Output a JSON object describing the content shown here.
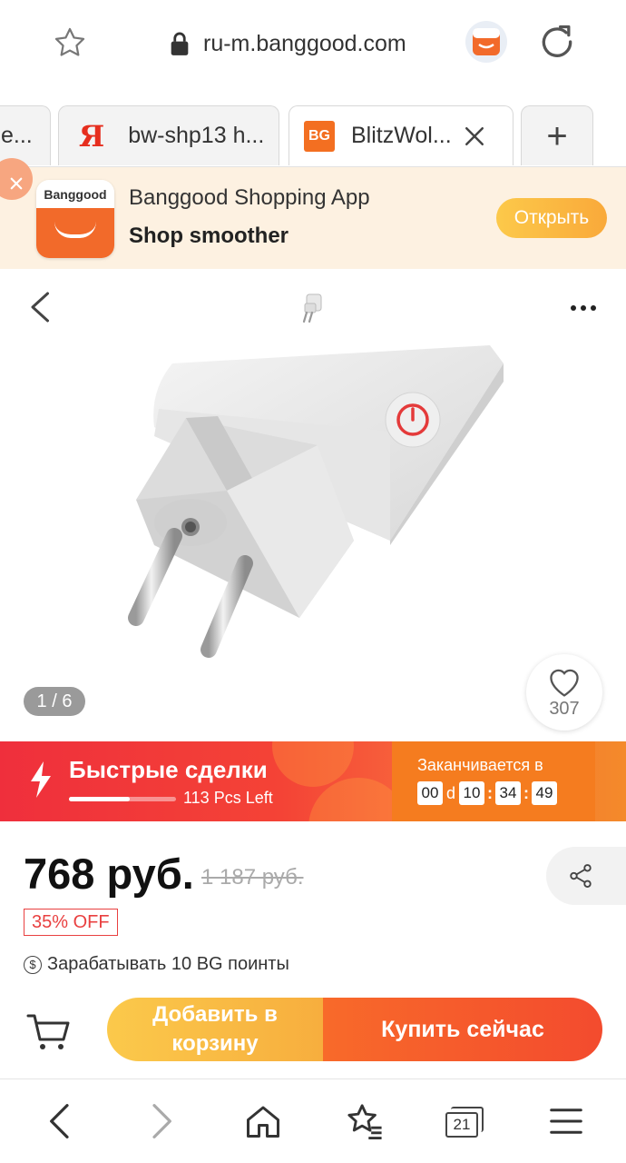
{
  "browser": {
    "url": "ru-m.banggood.com",
    "tabs": [
      {
        "label": "e..."
      },
      {
        "label": "bw-shp13 h..."
      },
      {
        "label": "BlitzWol..."
      }
    ],
    "favicon_text": "BG",
    "yandex_glyph": "Я",
    "new_tab_glyph": "+"
  },
  "app_banner": {
    "logo_text": "Banggood",
    "title": "Banggood Shopping App",
    "subtitle": "Shop smoother",
    "open_label": "Открыть"
  },
  "gallery": {
    "counter": "1 / 6",
    "likes": "307"
  },
  "flash_deal": {
    "title": "Быстрые сделки",
    "pcs_left": "113 Pcs Left",
    "progress": 0.57,
    "ends_label": "Заканчивается в",
    "days": "00",
    "day_unit": "d",
    "hours": "10",
    "minutes": "34",
    "seconds": "49",
    "sep": ":"
  },
  "price": {
    "current": "768 руб.",
    "old": "1 187 руб.",
    "discount": "35% OFF",
    "coin_glyph": "$",
    "points": "Зарабатывать 10 BG поинты"
  },
  "actions": {
    "add_to_cart": "Добавить в корзину",
    "buy_now": "Купить сейчас"
  },
  "bottom_nav": {
    "tab_count": "21"
  },
  "colors": {
    "accent_orange": "#f86a2a",
    "flash_red": "#ef2f3c",
    "discount_red": "#e94040",
    "cart_yellow": "#fbc94b"
  }
}
